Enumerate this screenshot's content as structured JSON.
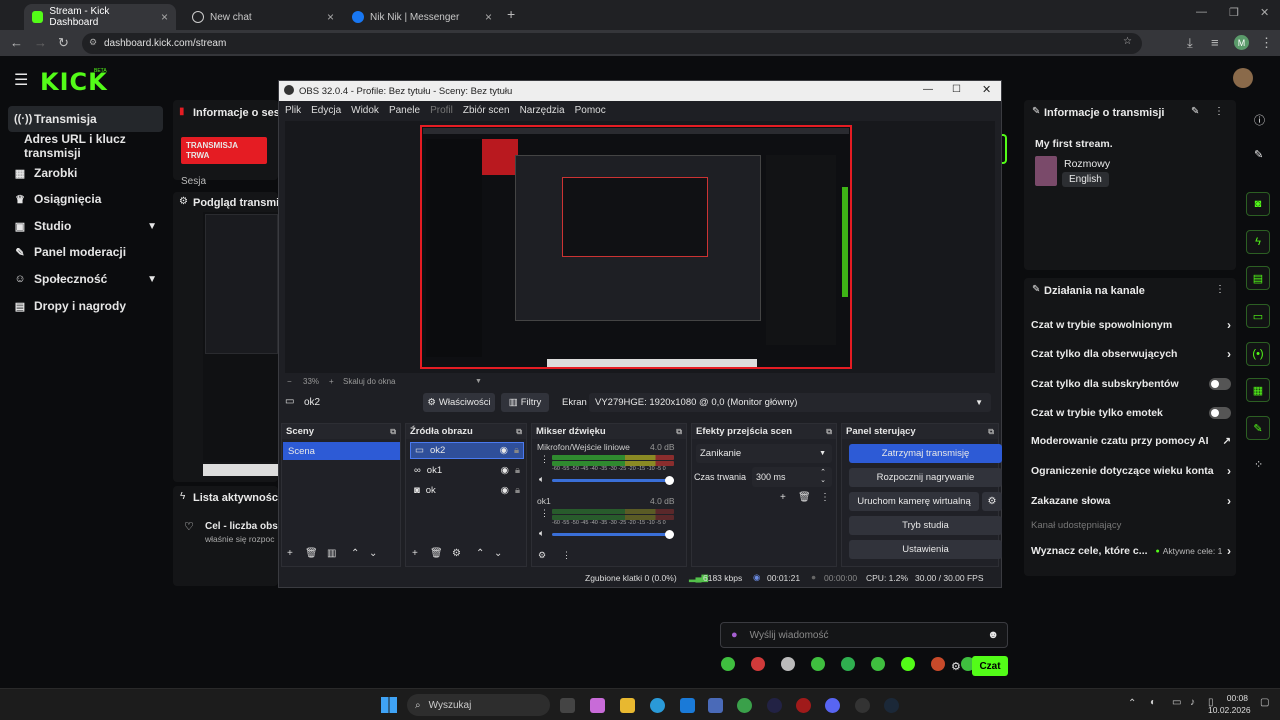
{
  "browser": {
    "tabs": [
      {
        "title": "Stream - Kick Dashboard",
        "active": true
      },
      {
        "title": "New chat",
        "active": false
      },
      {
        "title": "Nik Nik | Messenger",
        "active": false
      }
    ],
    "url": "dashboard.kick.com/stream",
    "profile_initial": "M"
  },
  "kick": {
    "logo": "KICK",
    "beta": "BETA",
    "sidebar": [
      {
        "label": "Transmisja",
        "icon": "broadcast-icon"
      },
      {
        "label": "Adres URL i klucz transmisji",
        "icon": ""
      },
      {
        "label": "Zarobki",
        "icon": "earnings-icon"
      },
      {
        "label": "Osiągnięcia",
        "icon": "trophy-icon"
      },
      {
        "label": "Studio",
        "icon": "studio-icon",
        "expand": true
      },
      {
        "label": "Panel moderacji",
        "icon": "wrench-icon"
      },
      {
        "label": "Społeczność",
        "icon": "people-icon",
        "expand": true
      },
      {
        "label": "Dropy i nagrody",
        "icon": "gift-icon"
      }
    ],
    "info_title": "Informacje o sesji",
    "live_badge": "TRANSMISJA TRWA",
    "session_label": "Sesja",
    "preview_title": "Podgląd transmisji",
    "activity_title": "Lista aktywności",
    "activity_item": "Cel - liczba obse",
    "activity_sub": "właśnie się rozpoc",
    "stream_info_title": "Informacje o transmisji",
    "stream_title": "My first stream.",
    "category": "Rozmowy",
    "language": "English",
    "channel_actions_title": "Działania na kanale",
    "actions": [
      {
        "label": "Czat w trybie spowolnionym",
        "end": "chevron"
      },
      {
        "label": "Czat tylko dla obserwujących",
        "end": "chevron"
      },
      {
        "label": "Czat tylko dla subskrybentów",
        "end": "toggle"
      },
      {
        "label": "Czat w trybie tylko emotek",
        "end": "toggle"
      },
      {
        "label": "Moderowanie czatu przy pomocy AI",
        "end": "external"
      },
      {
        "label": "Ograniczenie dotyczące wieku konta",
        "end": "chevron"
      },
      {
        "label": "Zakazane słowa",
        "end": "chevron"
      }
    ],
    "shared_channel": "Kanał udostępniający",
    "goals_label": "Wyznacz cele, które c...",
    "goals_active": "Aktywne cele: 1",
    "chat_placeholder": "Wyślij wiadomość",
    "chat_button": "Czat"
  },
  "obs": {
    "title": "OBS 32.0.4 - Profile: Bez tytułu - Sceny: Bez tytułu",
    "menu": [
      "Plik",
      "Edycja",
      "Widok",
      "Panele",
      "Profil",
      "Zbiór scen",
      "Narzędzia",
      "Pomoc"
    ],
    "zoom": "33%",
    "scale_label": "Skaluj do okna",
    "selected_source": "ok2",
    "properties_btn": "Właściwości",
    "filters_btn": "Filtry",
    "screen_label": "Ekran",
    "screen_value": "VY279HGE: 1920x1080 @ 0,0 (Monitor główny)",
    "docks": {
      "scenes": "Sceny",
      "sources": "Źródła obrazu",
      "mixer": "Mikser dźwięku",
      "transitions": "Efekty przejścia scen",
      "controls": "Panel sterujący"
    },
    "scene": "Scena",
    "sources": [
      "ok2",
      "ok1",
      "ok"
    ],
    "mixer": [
      {
        "name": "Mikrofon/Wejście liniowe",
        "db": "4.0 dB"
      },
      {
        "name": "ok1",
        "db": "4.0 dB"
      }
    ],
    "meter_scale": "-60 -55 -50 -45 -40 -35 -30 -25 -20 -15 -10 -5 0",
    "transition": "Zanikanie",
    "duration_label": "Czas trwania",
    "duration": "300 ms",
    "controls": [
      "Zatrzymaj transmisję",
      "Rozpocznij nagrywanie",
      "Uruchom kamerę wirtualną",
      "Tryb studia",
      "Ustawienia"
    ],
    "status": {
      "dropped": "Zgubione klatki 0 (0.0%)",
      "bitrate": "6183 kbps",
      "live_time": "00:01:21",
      "rec_time": "00:00:00",
      "cpu": "CPU: 1.2%",
      "fps": "30.00 / 30.00 FPS"
    }
  },
  "taskbar": {
    "search": "Wyszukaj",
    "time": "00:08",
    "date": "10.02.2026"
  },
  "colors": {
    "kick_green": "#53fc18",
    "live_red": "#e51c23",
    "obs_accent": "#2d5bd6"
  }
}
